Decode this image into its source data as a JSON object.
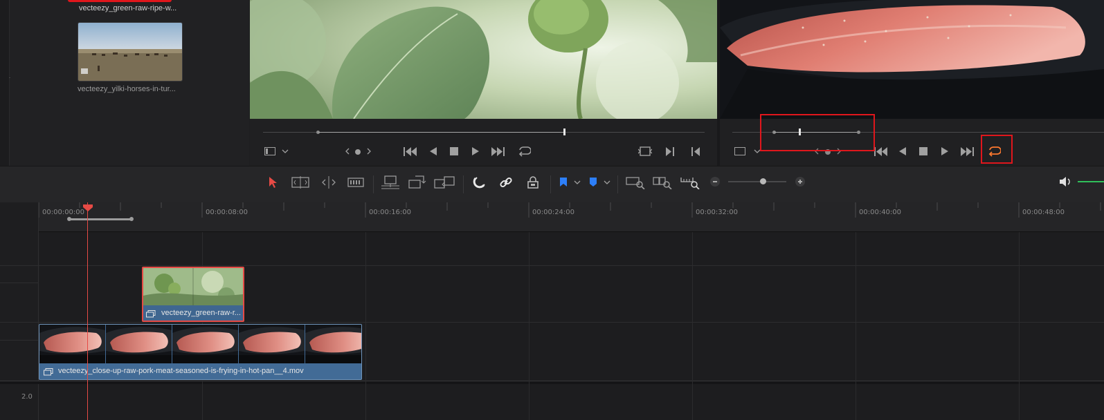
{
  "media_pool": {
    "clips": [
      {
        "name": "vecteezy_green-raw-ripe-w...",
        "selected": true
      },
      {
        "name": "vecteezy_yilki-horses-in-tur...",
        "selected": false
      }
    ]
  },
  "timeline": {
    "ruler_ticks": [
      "00:00:00:00",
      "00:00:08:00",
      "00:00:16:00",
      "00:00:24:00",
      "00:00:32:00",
      "00:00:40:00",
      "00:00:48:00"
    ],
    "audio_track_label": "2.0",
    "clips": {
      "video2": {
        "title": "vecteezy_green-raw-r..."
      },
      "video1": {
        "title": "vecteezy_close-up-raw-pork-meat-seasoned-is-frying-in-hot-pan__4.mov"
      }
    }
  },
  "colors": {
    "playhead": "#e64a45",
    "highlight": "#e0161c",
    "clip_blue": "#426b96",
    "flag_blue": "#2d7ff9",
    "audio_green": "#30c05a"
  },
  "icons": {
    "viewer_source": [
      "viewer-mode-icon",
      "chevron-down-icon",
      "prev-nav-icon",
      "nav-dot-icon",
      "next-nav-icon",
      "jump-start-icon",
      "reverse-play-icon",
      "stop-icon",
      "play-icon",
      "jump-end-icon",
      "loop-icon",
      "match-frame-icon",
      "mark-in-icon",
      "mark-out-icon"
    ],
    "toolbar": [
      "selection-tool-icon",
      "trim-tool-icon",
      "dynamic-trim-icon",
      "blade-tool-icon",
      "insert-clip-icon",
      "overwrite-clip-icon",
      "replace-clip-icon",
      "snapping-icon",
      "linked-selection-icon",
      "position-lock-icon",
      "flag-icon",
      "marker-icon",
      "zoom-full-icon",
      "zoom-detail-icon",
      "zoom-custom-icon",
      "zoom-out-icon",
      "zoom-in-icon",
      "volume-icon"
    ]
  }
}
